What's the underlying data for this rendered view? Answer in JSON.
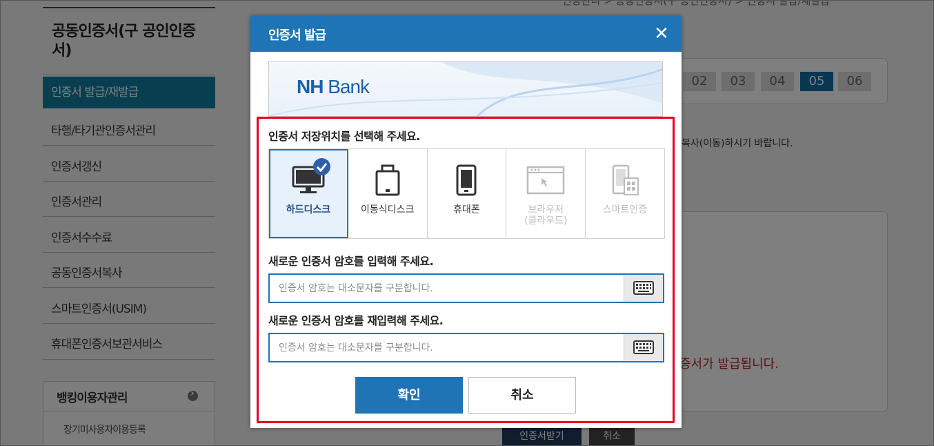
{
  "background": {
    "breadcrumb": "인증관리 > 공동인증서(구 공인인증서) > 인증서 발급/재발급",
    "sidebar": {
      "title": "공동인증서(구 공인인증서)",
      "active_item": "인증서 발급/재발급",
      "items": [
        "타행/타기관인증서관리",
        "인증서갱신",
        "인증서관리",
        "인증서수수료",
        "공동인증서복사",
        "스마트인증서(USIM)",
        "휴대폰인증서보관서비스"
      ],
      "box_title": "뱅킹이용자관리",
      "box_sub": "장기미사용자이용등록"
    },
    "steps": [
      "02",
      "03",
      "04",
      "05",
      "06"
    ],
    "active_step": "05",
    "note": "복사(이동)하시기 바랍니다.",
    "red_text": "증서가 발급됩니다.",
    "buttons": {
      "receive": "인증서받기",
      "cancel": "취소"
    }
  },
  "modal": {
    "title": "인증서 발급",
    "close": "X",
    "banner": {
      "logo_nh": "NH",
      "logo_bank": "Bank"
    },
    "storage": {
      "title": "인증서 저장위치를 선택해 주세요.",
      "options": [
        {
          "label": "하드디스크",
          "icon": "monitor-icon",
          "selected": true
        },
        {
          "label": "이동식디스크",
          "icon": "usb-drive-icon"
        },
        {
          "label": "휴대폰",
          "icon": "phone-icon"
        },
        {
          "label": "브라우저\n(클라우드)",
          "icon": "browser-icon",
          "disabled": true
        },
        {
          "label": "스마트인증",
          "icon": "smart-cert-icon",
          "disabled": true
        }
      ]
    },
    "password": {
      "title": "새로운 인증서 암호를 입력해 주세요.",
      "placeholder": "인증서 암호는 대소문자를 구분합니다.",
      "value": ""
    },
    "password_confirm": {
      "title": "새로운 인증서 암호를 재입력해 주세요.",
      "placeholder": "인증서 암호는 대소문자를 구분합니다.",
      "value": ""
    },
    "confirm_label": "확인",
    "cancel_label": "취소"
  },
  "colors": {
    "primary": "#1f74b6",
    "highlight": "#e8001c",
    "sidebar_active": "#0e7ea3"
  }
}
